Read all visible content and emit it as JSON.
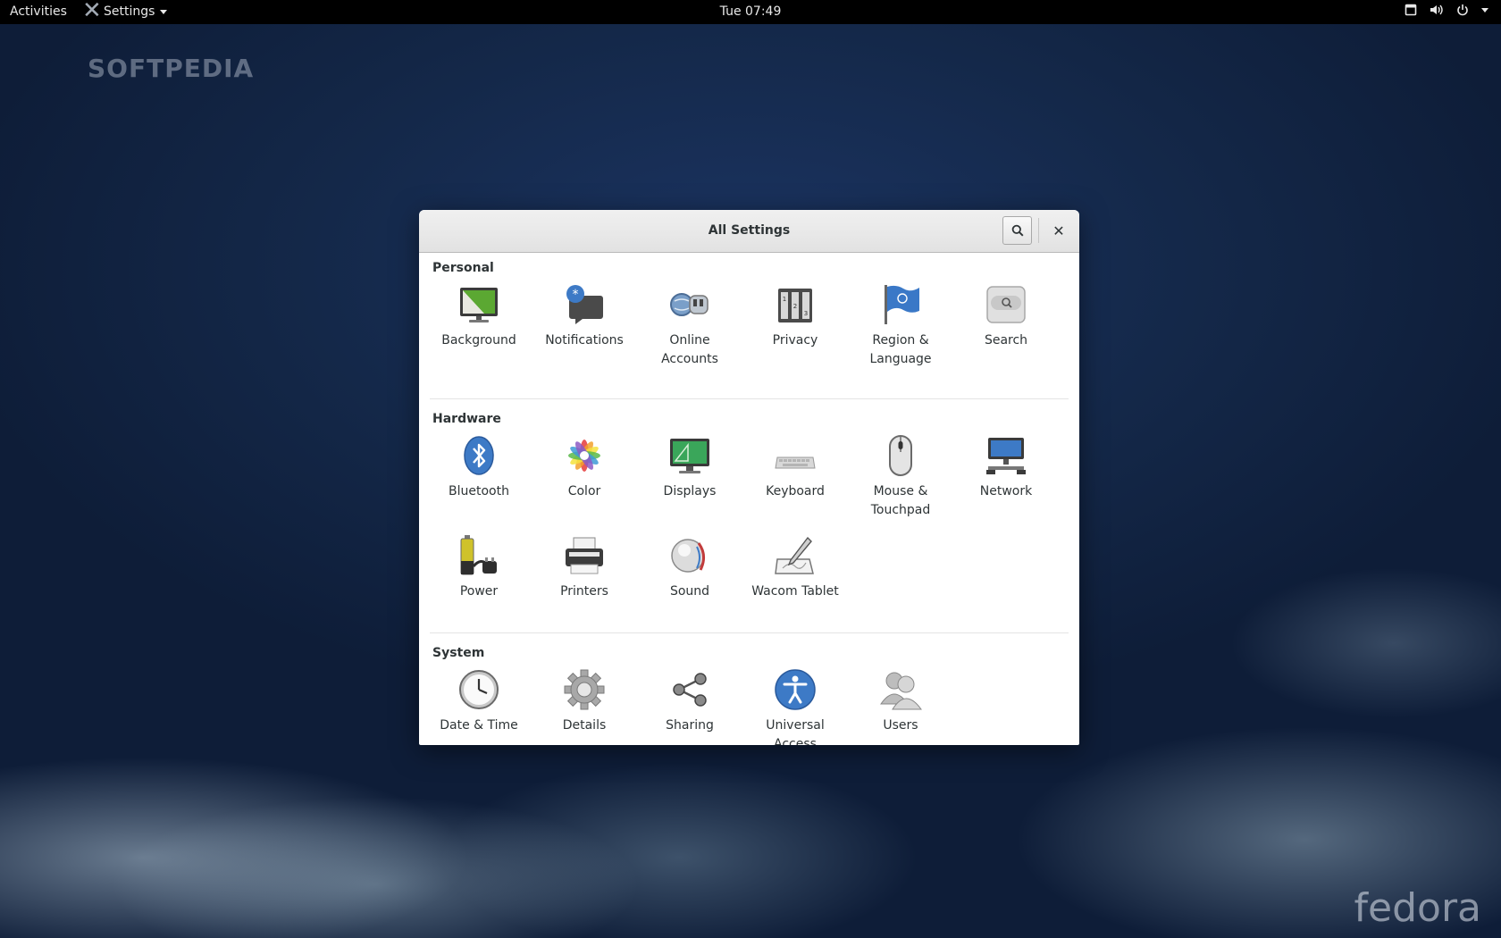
{
  "topbar": {
    "activities": "Activities",
    "app_menu": "Settings",
    "clock": "Tue 07:49"
  },
  "watermarks": {
    "top_left": "SOFTPEDIA",
    "bottom_right": "fedora"
  },
  "window": {
    "title": "All Settings"
  },
  "sections": {
    "personal": {
      "label": "Personal",
      "items": [
        {
          "label": "Background",
          "icon": "background-icon"
        },
        {
          "label": "Notifications",
          "icon": "notifications-icon"
        },
        {
          "label": "Online\nAccounts",
          "icon": "online-accounts-icon"
        },
        {
          "label": "Privacy",
          "icon": "privacy-icon"
        },
        {
          "label": "Region &\nLanguage",
          "icon": "region-language-icon"
        },
        {
          "label": "Search",
          "icon": "search-settings-icon"
        }
      ]
    },
    "hardware": {
      "label": "Hardware",
      "items": [
        {
          "label": "Bluetooth",
          "icon": "bluetooth-icon"
        },
        {
          "label": "Color",
          "icon": "color-icon"
        },
        {
          "label": "Displays",
          "icon": "displays-icon"
        },
        {
          "label": "Keyboard",
          "icon": "keyboard-icon"
        },
        {
          "label": "Mouse &\nTouchpad",
          "icon": "mouse-touchpad-icon"
        },
        {
          "label": "Network",
          "icon": "network-icon"
        },
        {
          "label": "Power",
          "icon": "power-battery-icon"
        },
        {
          "label": "Printers",
          "icon": "printer-icon"
        },
        {
          "label": "Sound",
          "icon": "sound-icon"
        },
        {
          "label": "Wacom Tablet",
          "icon": "wacom-tablet-icon"
        }
      ]
    },
    "system": {
      "label": "System",
      "items": [
        {
          "label": "Date & Time",
          "icon": "clock-icon"
        },
        {
          "label": "Details",
          "icon": "gear-icon"
        },
        {
          "label": "Sharing",
          "icon": "share-icon"
        },
        {
          "label": "Universal\nAccess",
          "icon": "accessibility-icon"
        },
        {
          "label": "Users",
          "icon": "users-icon"
        }
      ]
    }
  },
  "colors": {
    "topbar": "#000000",
    "desktop": "#142849",
    "accent_blue": "#3d7ac6"
  }
}
